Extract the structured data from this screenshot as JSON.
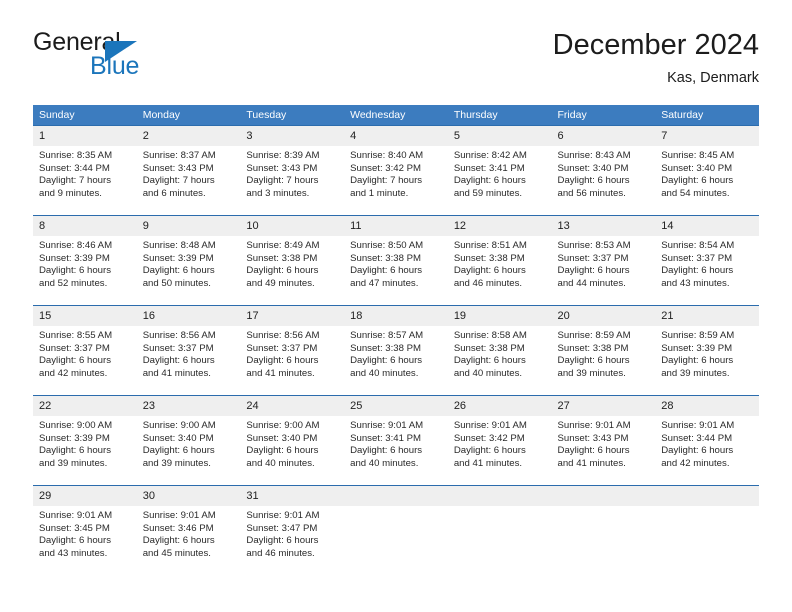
{
  "brand": {
    "name_part1": "General",
    "name_part2": "Blue",
    "logo_icon": "triangle-icon",
    "accent_color": "#1b75bb"
  },
  "header": {
    "title": "December 2024",
    "subtitle": "Kas, Denmark"
  },
  "calendar": {
    "header_bg": "#3c7cbf",
    "daynum_bg": "#efefef",
    "row_separator_color": "#2b6cad",
    "weekday_headers": [
      "Sunday",
      "Monday",
      "Tuesday",
      "Wednesday",
      "Thursday",
      "Friday",
      "Saturday"
    ],
    "weeks": [
      [
        {
          "day": "1",
          "sunrise": "Sunrise: 8:35 AM",
          "sunset": "Sunset: 3:44 PM",
          "daylight_line1": "Daylight: 7 hours",
          "daylight_line2": "and 9 minutes."
        },
        {
          "day": "2",
          "sunrise": "Sunrise: 8:37 AM",
          "sunset": "Sunset: 3:43 PM",
          "daylight_line1": "Daylight: 7 hours",
          "daylight_line2": "and 6 minutes."
        },
        {
          "day": "3",
          "sunrise": "Sunrise: 8:39 AM",
          "sunset": "Sunset: 3:43 PM",
          "daylight_line1": "Daylight: 7 hours",
          "daylight_line2": "and 3 minutes."
        },
        {
          "day": "4",
          "sunrise": "Sunrise: 8:40 AM",
          "sunset": "Sunset: 3:42 PM",
          "daylight_line1": "Daylight: 7 hours",
          "daylight_line2": "and 1 minute."
        },
        {
          "day": "5",
          "sunrise": "Sunrise: 8:42 AM",
          "sunset": "Sunset: 3:41 PM",
          "daylight_line1": "Daylight: 6 hours",
          "daylight_line2": "and 59 minutes."
        },
        {
          "day": "6",
          "sunrise": "Sunrise: 8:43 AM",
          "sunset": "Sunset: 3:40 PM",
          "daylight_line1": "Daylight: 6 hours",
          "daylight_line2": "and 56 minutes."
        },
        {
          "day": "7",
          "sunrise": "Sunrise: 8:45 AM",
          "sunset": "Sunset: 3:40 PM",
          "daylight_line1": "Daylight: 6 hours",
          "daylight_line2": "and 54 minutes."
        }
      ],
      [
        {
          "day": "8",
          "sunrise": "Sunrise: 8:46 AM",
          "sunset": "Sunset: 3:39 PM",
          "daylight_line1": "Daylight: 6 hours",
          "daylight_line2": "and 52 minutes."
        },
        {
          "day": "9",
          "sunrise": "Sunrise: 8:48 AM",
          "sunset": "Sunset: 3:39 PM",
          "daylight_line1": "Daylight: 6 hours",
          "daylight_line2": "and 50 minutes."
        },
        {
          "day": "10",
          "sunrise": "Sunrise: 8:49 AM",
          "sunset": "Sunset: 3:38 PM",
          "daylight_line1": "Daylight: 6 hours",
          "daylight_line2": "and 49 minutes."
        },
        {
          "day": "11",
          "sunrise": "Sunrise: 8:50 AM",
          "sunset": "Sunset: 3:38 PM",
          "daylight_line1": "Daylight: 6 hours",
          "daylight_line2": "and 47 minutes."
        },
        {
          "day": "12",
          "sunrise": "Sunrise: 8:51 AM",
          "sunset": "Sunset: 3:38 PM",
          "daylight_line1": "Daylight: 6 hours",
          "daylight_line2": "and 46 minutes."
        },
        {
          "day": "13",
          "sunrise": "Sunrise: 8:53 AM",
          "sunset": "Sunset: 3:37 PM",
          "daylight_line1": "Daylight: 6 hours",
          "daylight_line2": "and 44 minutes."
        },
        {
          "day": "14",
          "sunrise": "Sunrise: 8:54 AM",
          "sunset": "Sunset: 3:37 PM",
          "daylight_line1": "Daylight: 6 hours",
          "daylight_line2": "and 43 minutes."
        }
      ],
      [
        {
          "day": "15",
          "sunrise": "Sunrise: 8:55 AM",
          "sunset": "Sunset: 3:37 PM",
          "daylight_line1": "Daylight: 6 hours",
          "daylight_line2": "and 42 minutes."
        },
        {
          "day": "16",
          "sunrise": "Sunrise: 8:56 AM",
          "sunset": "Sunset: 3:37 PM",
          "daylight_line1": "Daylight: 6 hours",
          "daylight_line2": "and 41 minutes."
        },
        {
          "day": "17",
          "sunrise": "Sunrise: 8:56 AM",
          "sunset": "Sunset: 3:37 PM",
          "daylight_line1": "Daylight: 6 hours",
          "daylight_line2": "and 41 minutes."
        },
        {
          "day": "18",
          "sunrise": "Sunrise: 8:57 AM",
          "sunset": "Sunset: 3:38 PM",
          "daylight_line1": "Daylight: 6 hours",
          "daylight_line2": "and 40 minutes."
        },
        {
          "day": "19",
          "sunrise": "Sunrise: 8:58 AM",
          "sunset": "Sunset: 3:38 PM",
          "daylight_line1": "Daylight: 6 hours",
          "daylight_line2": "and 40 minutes."
        },
        {
          "day": "20",
          "sunrise": "Sunrise: 8:59 AM",
          "sunset": "Sunset: 3:38 PM",
          "daylight_line1": "Daylight: 6 hours",
          "daylight_line2": "and 39 minutes."
        },
        {
          "day": "21",
          "sunrise": "Sunrise: 8:59 AM",
          "sunset": "Sunset: 3:39 PM",
          "daylight_line1": "Daylight: 6 hours",
          "daylight_line2": "and 39 minutes."
        }
      ],
      [
        {
          "day": "22",
          "sunrise": "Sunrise: 9:00 AM",
          "sunset": "Sunset: 3:39 PM",
          "daylight_line1": "Daylight: 6 hours",
          "daylight_line2": "and 39 minutes."
        },
        {
          "day": "23",
          "sunrise": "Sunrise: 9:00 AM",
          "sunset": "Sunset: 3:40 PM",
          "daylight_line1": "Daylight: 6 hours",
          "daylight_line2": "and 39 minutes."
        },
        {
          "day": "24",
          "sunrise": "Sunrise: 9:00 AM",
          "sunset": "Sunset: 3:40 PM",
          "daylight_line1": "Daylight: 6 hours",
          "daylight_line2": "and 40 minutes."
        },
        {
          "day": "25",
          "sunrise": "Sunrise: 9:01 AM",
          "sunset": "Sunset: 3:41 PM",
          "daylight_line1": "Daylight: 6 hours",
          "daylight_line2": "and 40 minutes."
        },
        {
          "day": "26",
          "sunrise": "Sunrise: 9:01 AM",
          "sunset": "Sunset: 3:42 PM",
          "daylight_line1": "Daylight: 6 hours",
          "daylight_line2": "and 41 minutes."
        },
        {
          "day": "27",
          "sunrise": "Sunrise: 9:01 AM",
          "sunset": "Sunset: 3:43 PM",
          "daylight_line1": "Daylight: 6 hours",
          "daylight_line2": "and 41 minutes."
        },
        {
          "day": "28",
          "sunrise": "Sunrise: 9:01 AM",
          "sunset": "Sunset: 3:44 PM",
          "daylight_line1": "Daylight: 6 hours",
          "daylight_line2": "and 42 minutes."
        }
      ],
      [
        {
          "day": "29",
          "sunrise": "Sunrise: 9:01 AM",
          "sunset": "Sunset: 3:45 PM",
          "daylight_line1": "Daylight: 6 hours",
          "daylight_line2": "and 43 minutes."
        },
        {
          "day": "30",
          "sunrise": "Sunrise: 9:01 AM",
          "sunset": "Sunset: 3:46 PM",
          "daylight_line1": "Daylight: 6 hours",
          "daylight_line2": "and 45 minutes."
        },
        {
          "day": "31",
          "sunrise": "Sunrise: 9:01 AM",
          "sunset": "Sunset: 3:47 PM",
          "daylight_line1": "Daylight: 6 hours",
          "daylight_line2": "and 46 minutes."
        },
        {
          "day": "",
          "sunrise": "",
          "sunset": "",
          "daylight_line1": "",
          "daylight_line2": ""
        },
        {
          "day": "",
          "sunrise": "",
          "sunset": "",
          "daylight_line1": "",
          "daylight_line2": ""
        },
        {
          "day": "",
          "sunrise": "",
          "sunset": "",
          "daylight_line1": "",
          "daylight_line2": ""
        },
        {
          "day": "",
          "sunrise": "",
          "sunset": "",
          "daylight_line1": "",
          "daylight_line2": ""
        }
      ]
    ]
  }
}
